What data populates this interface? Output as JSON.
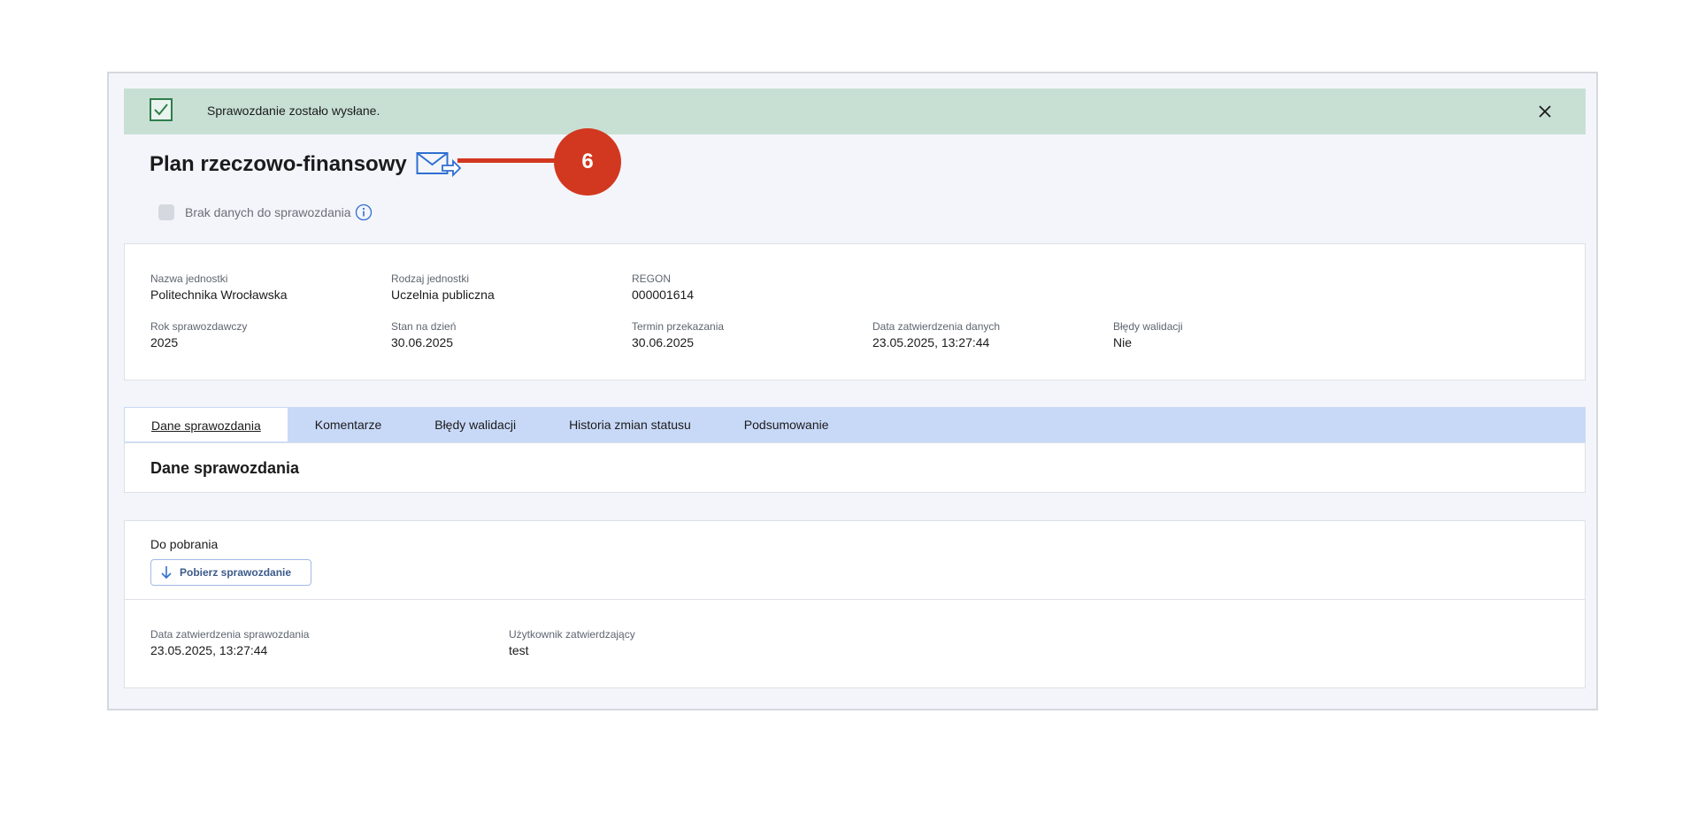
{
  "alert": {
    "message": "Sprawozdanie zostało wysłane."
  },
  "header": {
    "title": "Plan rzeczowo-finansowy",
    "callout_number": "6"
  },
  "no_data": {
    "label": "Brak danych do sprawozdania",
    "checked": false
  },
  "info": {
    "row1": [
      {
        "label": "Nazwa jednostki",
        "value": "Politechnika Wrocławska"
      },
      {
        "label": "Rodzaj jednostki",
        "value": "Uczelnia publiczna"
      },
      {
        "label": "REGON",
        "value": "000001614"
      }
    ],
    "row2": [
      {
        "label": "Rok sprawozdawczy",
        "value": "2025"
      },
      {
        "label": "Stan na dzień",
        "value": "30.06.2025"
      },
      {
        "label": "Termin przekazania",
        "value": "30.06.2025"
      },
      {
        "label": "Data zatwierdzenia danych",
        "value": "23.05.2025, 13:27:44"
      },
      {
        "label": "Błędy walidacji",
        "value": "Nie"
      }
    ]
  },
  "tabs": [
    {
      "label": "Dane sprawozdania",
      "active": true
    },
    {
      "label": "Komentarze",
      "active": false
    },
    {
      "label": "Błędy walidacji",
      "active": false
    },
    {
      "label": "Historia zmian statusu",
      "active": false
    },
    {
      "label": "Podsumowanie",
      "active": false
    }
  ],
  "tab_content": {
    "title": "Dane sprawozdania"
  },
  "downloads": {
    "label": "Do pobrania",
    "button_label": "Pobierz sprawozdanie"
  },
  "approval": [
    {
      "label": "Data zatwierdzenia sprawozdania",
      "value": "23.05.2025, 13:27:44"
    },
    {
      "label": "Użytkownik zatwierdzający",
      "value": "test"
    }
  ],
  "colors": {
    "alert_bg": "#c8e0d4",
    "tabs_bg": "#c8d9f8",
    "callout": "#d2381f",
    "icon_blue": "#2f6fd0"
  }
}
